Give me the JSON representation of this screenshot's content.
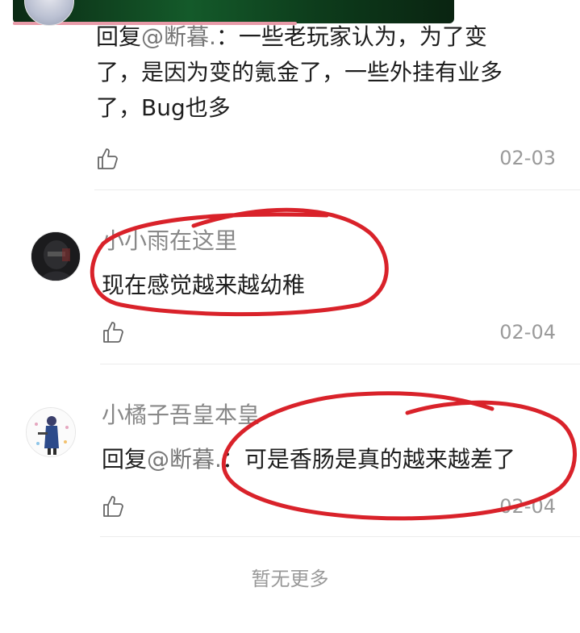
{
  "comments": [
    {
      "prefix": "回复",
      "mention": "@断暮.",
      "line1_rest": "：一些老玩家认为，为了变",
      "line2": "了，是因为变的氪金了，一些外挂有业多",
      "line3": "了，Bug也多",
      "date": "02-03"
    },
    {
      "username": "小小雨在这里",
      "text": "现在感觉越来越幼稚",
      "date": "02-04"
    },
    {
      "username": "小橘子吾皇本皇",
      "prefix": "回复",
      "mention": "@断暮.",
      "rest": "：可是香肠是真的越来越差了",
      "date": "02-04"
    }
  ],
  "footer": {
    "no_more": "暂无更多"
  },
  "annotation_color": "#d9222a"
}
